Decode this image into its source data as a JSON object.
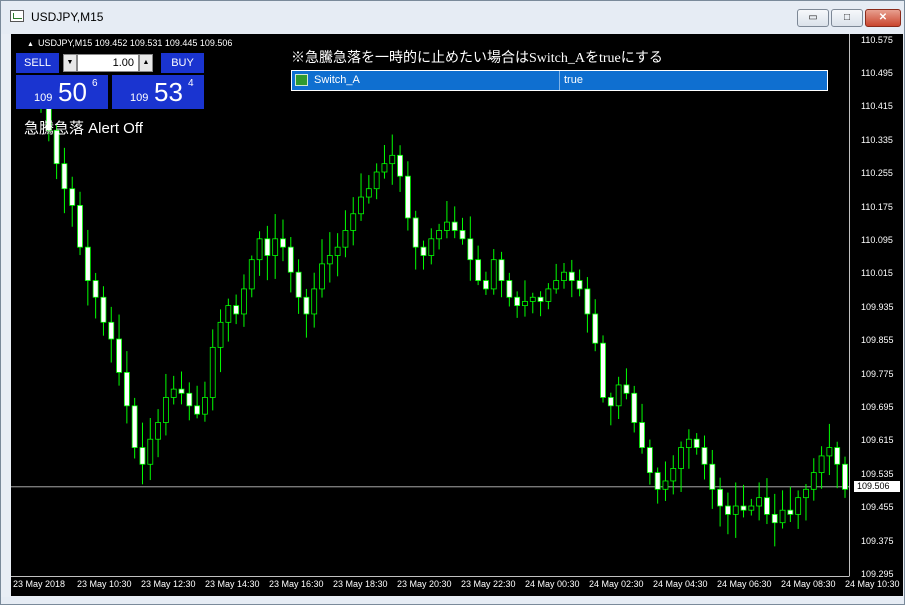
{
  "window": {
    "title": "USDJPY,M15",
    "minimize_glyph": "▭",
    "maximize_glyph": "□",
    "close_glyph": "✕",
    "icon": "chart-window-icon"
  },
  "chart_header": {
    "symbol_glyph": "▲",
    "symbol_line": "USDJPY,M15  109.452 109.531 109.445 109.506"
  },
  "one_click_trading": {
    "sell_label": "SELL",
    "buy_label": "BUY",
    "lot_down_glyph": "▼",
    "lot_up_glyph": "▲",
    "lot_value": "1.00",
    "sell_price": {
      "big": "109",
      "mid": "50",
      "sup": "6"
    },
    "buy_price": {
      "big": "109",
      "mid": "53",
      "sup": "4"
    }
  },
  "alert_label": "急騰急落 Alert Off",
  "note_text": "※急騰急落を一時的に止めたい場合はSwitch_Aをtrueにする",
  "parameter": {
    "name": "Switch_A",
    "value": "true",
    "icon": "parameter-icon"
  },
  "price_axis": {
    "labels": [
      "110.575",
      "110.495",
      "110.415",
      "110.335",
      "110.255",
      "110.175",
      "110.095",
      "110.015",
      "109.935",
      "109.855",
      "109.775",
      "109.695",
      "109.615",
      "109.535",
      "109.455",
      "109.375",
      "109.295"
    ],
    "current_price": "109.506"
  },
  "time_axis": {
    "labels": [
      "23 May 2018",
      "23 May 10:30",
      "23 May 12:30",
      "23 May 14:30",
      "23 May 16:30",
      "23 May 18:30",
      "23 May 20:30",
      "23 May 22:30",
      "24 May 00:30",
      "24 May 02:30",
      "24 May 04:30",
      "24 May 06:30",
      "24 May 08:30",
      "24 May 10:30"
    ]
  },
  "colors": {
    "background": "#000000",
    "bull_candle": "#00ff00",
    "bear_candle": "#ffffff",
    "trade_panel": "#1a34d0",
    "parameter_row": "#0f6fd0",
    "bid_line": "#c0c0c0"
  },
  "chart_data": {
    "type": "candlestick",
    "symbol": "USDJPY",
    "timeframe": "M15",
    "ylim": [
      109.295,
      110.575
    ],
    "current_bid": 109.506,
    "close_series": [
      110.42,
      110.36,
      110.28,
      110.22,
      110.18,
      110.08,
      110.0,
      109.96,
      109.9,
      109.86,
      109.78,
      109.7,
      109.6,
      109.56,
      109.62,
      109.66,
      109.72,
      109.74,
      109.73,
      109.7,
      109.68,
      109.72,
      109.84,
      109.9,
      109.94,
      109.92,
      109.98,
      110.05,
      110.1,
      110.06,
      110.1,
      110.08,
      110.02,
      109.96,
      109.92,
      109.98,
      110.04,
      110.06,
      110.08,
      110.12,
      110.16,
      110.2,
      110.22,
      110.26,
      110.28,
      110.3,
      110.25,
      110.15,
      110.08,
      110.06,
      110.1,
      110.12,
      110.14,
      110.12,
      110.1,
      110.05,
      110.0,
      109.98,
      110.05,
      110.0,
      109.96,
      109.94,
      109.95,
      109.96,
      109.95,
      109.98,
      110.0,
      110.02,
      110.0,
      109.98,
      109.92,
      109.85,
      109.72,
      109.7,
      109.75,
      109.73,
      109.66,
      109.6,
      109.54,
      109.5,
      109.52,
      109.55,
      109.6,
      109.62,
      109.6,
      109.56,
      109.5,
      109.46,
      109.44,
      109.46,
      109.45,
      109.46,
      109.48,
      109.44,
      109.42,
      109.45,
      109.44,
      109.48,
      109.5,
      109.54,
      109.58,
      109.6,
      109.56,
      109.5
    ]
  }
}
